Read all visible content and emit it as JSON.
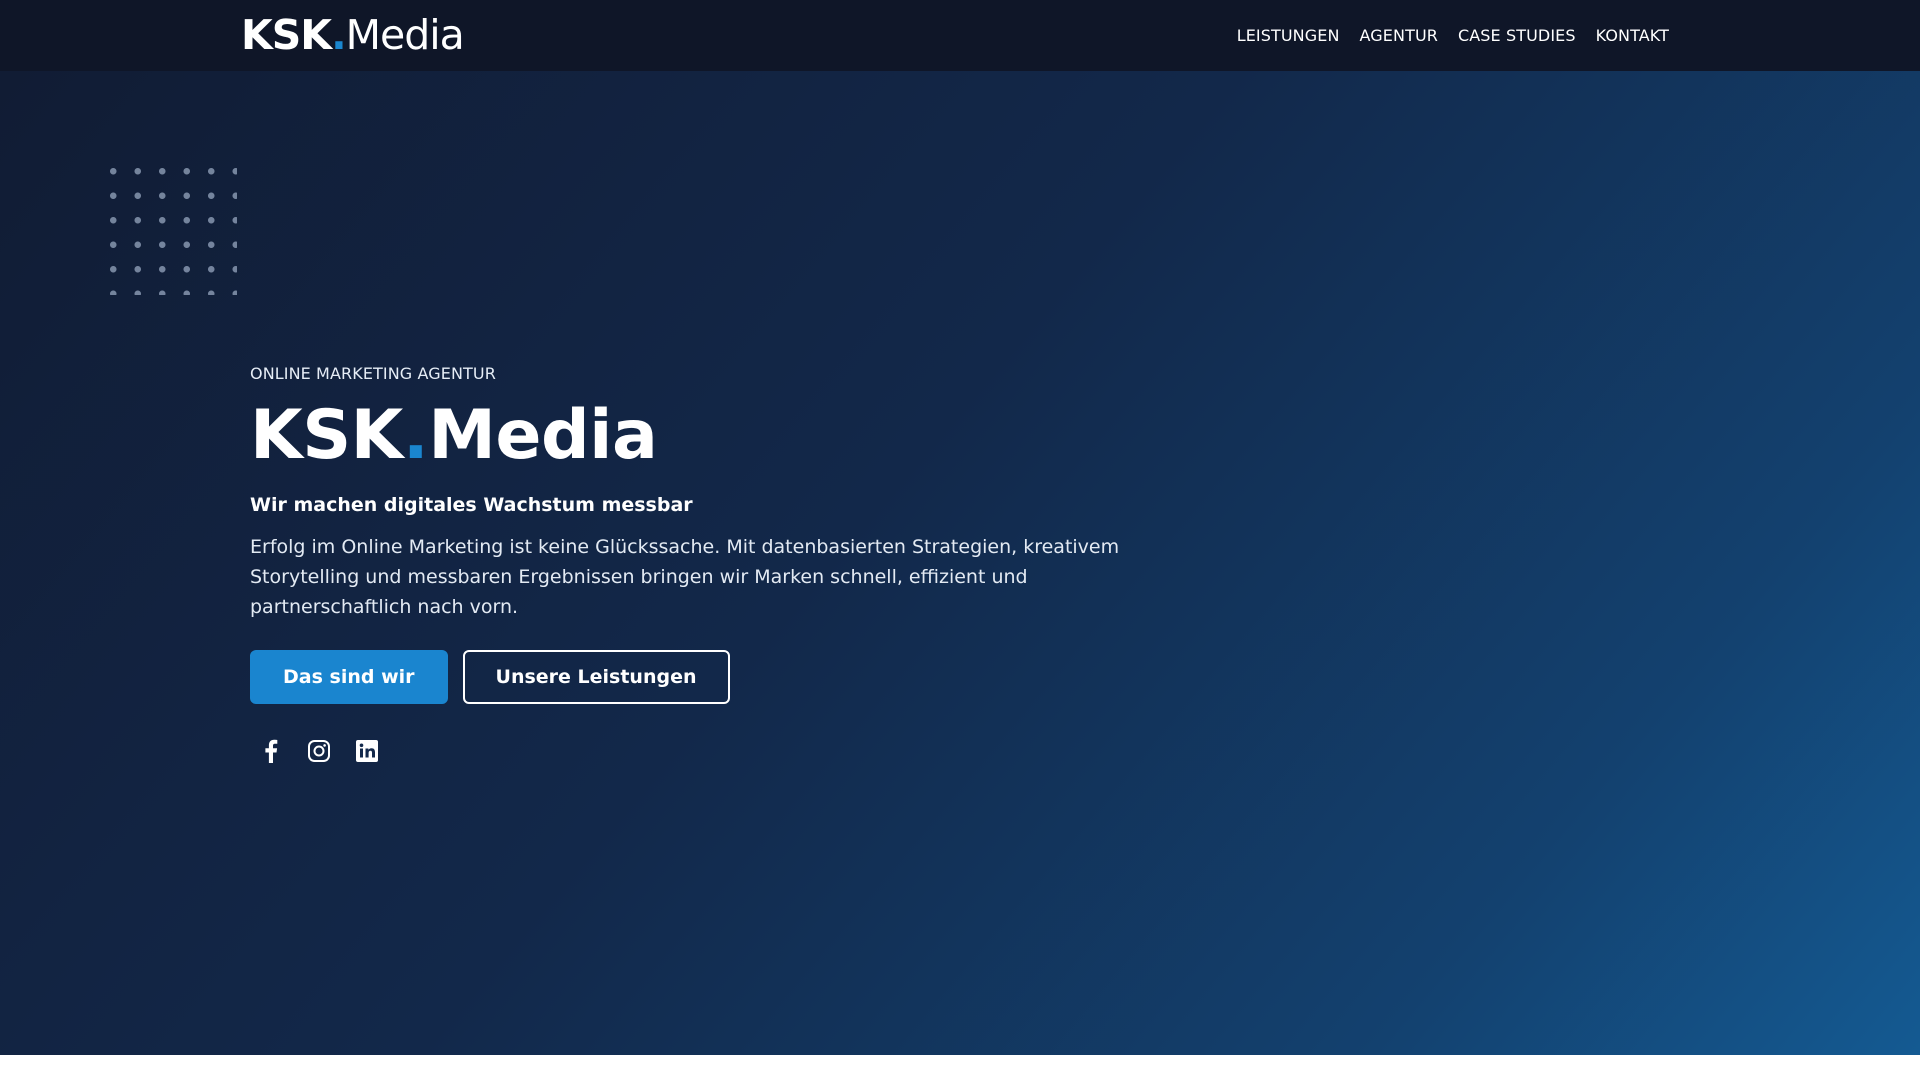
{
  "header": {
    "logo": {
      "bold": "KSK",
      "dot": ".",
      "light": "Media"
    },
    "nav": [
      {
        "label": "LEISTUNGEN"
      },
      {
        "label": "AGENTUR"
      },
      {
        "label": "CASE STUDIES"
      },
      {
        "label": "KONTAKT"
      }
    ]
  },
  "hero": {
    "eyebrow": "ONLINE MARKETING AGENTUR",
    "title": {
      "bold": "KSK",
      "dot": ".",
      "rest": "Media"
    },
    "subtitle": "Wir machen digitales Wachstum messbar",
    "description": "Erfolg im Online Marketing ist keine Glückssache. Mit datenbasierten Strategien, kreativem Storytelling und messbaren Ergebnissen bringen wir Marken schnell, effizient und partnerschaftlich nach vorn.",
    "buttons": {
      "primary": "Das sind wir",
      "secondary": "Unsere Leistungen"
    },
    "socials": [
      {
        "icon": "facebook-icon"
      },
      {
        "icon": "instagram-icon"
      },
      {
        "icon": "linkedin-icon"
      }
    ]
  },
  "colors": {
    "accent": "#1a86cf",
    "header_bg": "#0f1628",
    "hero_gradient_start": "#111c34",
    "hero_gradient_end": "#145a92"
  }
}
